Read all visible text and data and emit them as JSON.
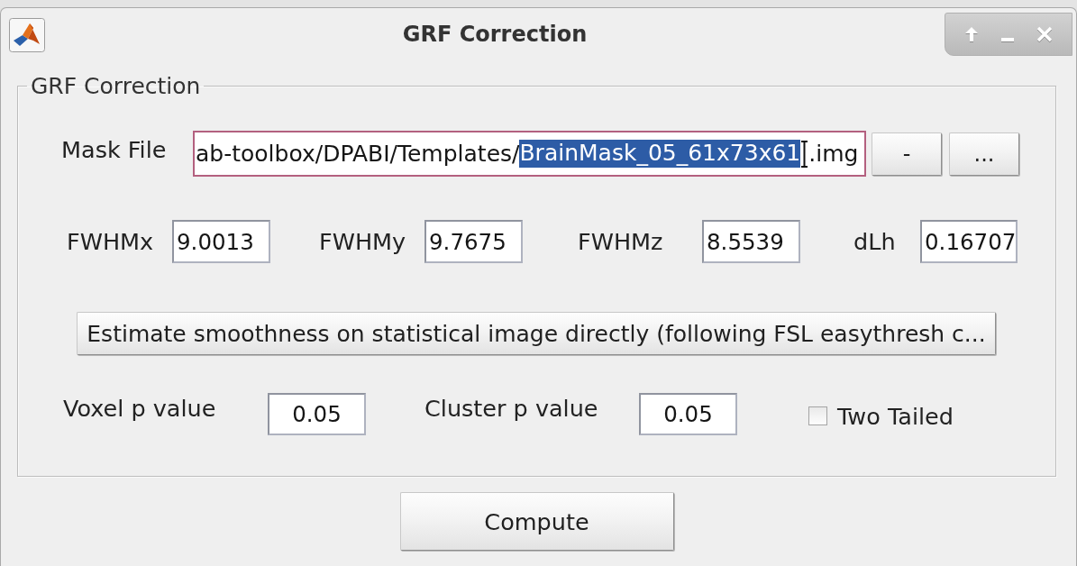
{
  "window": {
    "title": "GRF Correction"
  },
  "group": {
    "title": "GRF Correction",
    "mask_file": {
      "label": "Mask File",
      "text_before": "ab-toolbox/DPABI/Templates/",
      "selected_text": "BrainMask_05_61x73x61",
      "text_after": ".img",
      "focused": true
    },
    "mask_buttons": [
      "-",
      "..."
    ],
    "fwhm": [
      {
        "label": "FWHMx",
        "value": "9.0013"
      },
      {
        "label": "FWHMy",
        "value": "9.7675"
      },
      {
        "label": "FWHMz",
        "value": "8.5539"
      },
      {
        "label": "dLh",
        "value": "0.16707"
      }
    ],
    "estimate_button": "Estimate smoothness on statistical image directly (following FSL easythresh c...",
    "thresholds": [
      {
        "label": "Voxel p value",
        "value": "0.05"
      },
      {
        "label": "Cluster p value",
        "value": "0.05"
      }
    ],
    "two_tailed": {
      "label": "Two Tailed",
      "checked": false
    }
  },
  "compute_button": "Compute"
}
